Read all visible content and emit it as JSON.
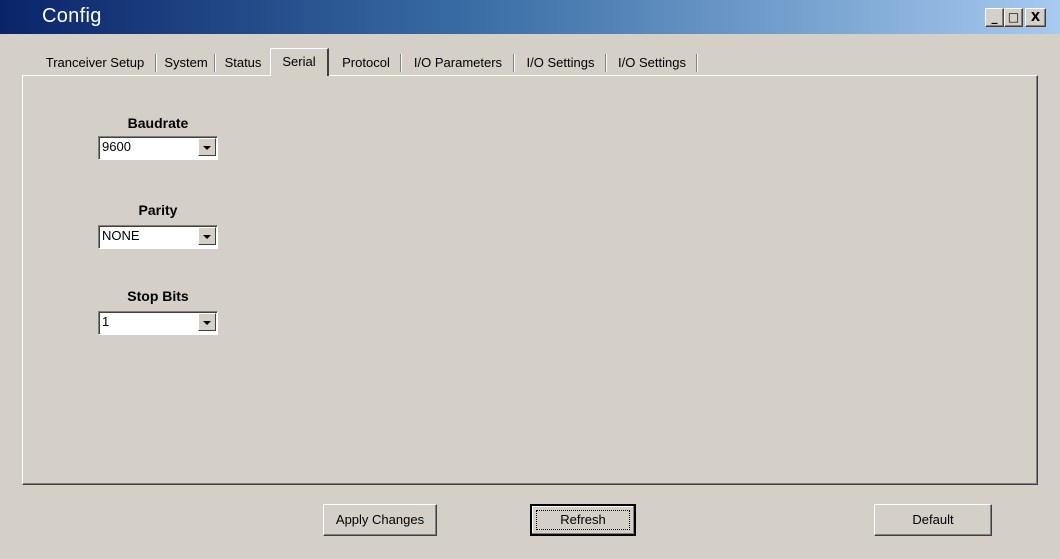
{
  "window": {
    "title": "Config",
    "minimize_icon": "minimize-icon",
    "maximize_icon": "maximize-icon",
    "close_icon": "close-icon",
    "minimize_glyph": "_",
    "maximize_glyph": "□",
    "close_glyph": "X"
  },
  "tabs": [
    {
      "label": "Tranceiver Setup",
      "active": false
    },
    {
      "label": "System",
      "active": false
    },
    {
      "label": "Status",
      "active": false
    },
    {
      "label": "Serial",
      "active": true
    },
    {
      "label": "Protocol",
      "active": false
    },
    {
      "label": "I/O Parameters",
      "active": false
    },
    {
      "label": "I/O Settings",
      "active": false
    },
    {
      "label": "I/O Settings",
      "active": false
    }
  ],
  "serial": {
    "baudrate": {
      "label": "Baudrate",
      "value": "9600"
    },
    "parity": {
      "label": "Parity",
      "value": "NONE"
    },
    "stop_bits": {
      "label": "Stop Bits",
      "value": "1"
    }
  },
  "buttons": {
    "apply": "Apply Changes",
    "refresh": "Refresh",
    "default": "Default"
  }
}
